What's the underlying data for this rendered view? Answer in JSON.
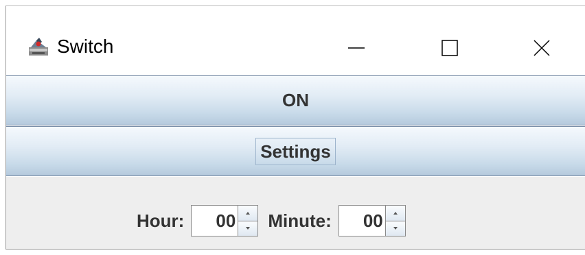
{
  "window": {
    "title": "Switch",
    "icons": {
      "app": "java-app-icon",
      "minimize": "minimize-icon",
      "maximize": "maximize-icon",
      "close": "close-icon"
    }
  },
  "buttons": {
    "on_label": "ON",
    "settings_label": "Settings"
  },
  "time": {
    "hour_label": "Hour:",
    "hour_value": "00",
    "minute_label": "Minute:",
    "minute_value": "00"
  },
  "colors": {
    "button_gradient_top": "#f5f9fd",
    "button_gradient_bottom": "#b5cadd",
    "panel_background": "#eeeeee",
    "text": "#333333"
  }
}
